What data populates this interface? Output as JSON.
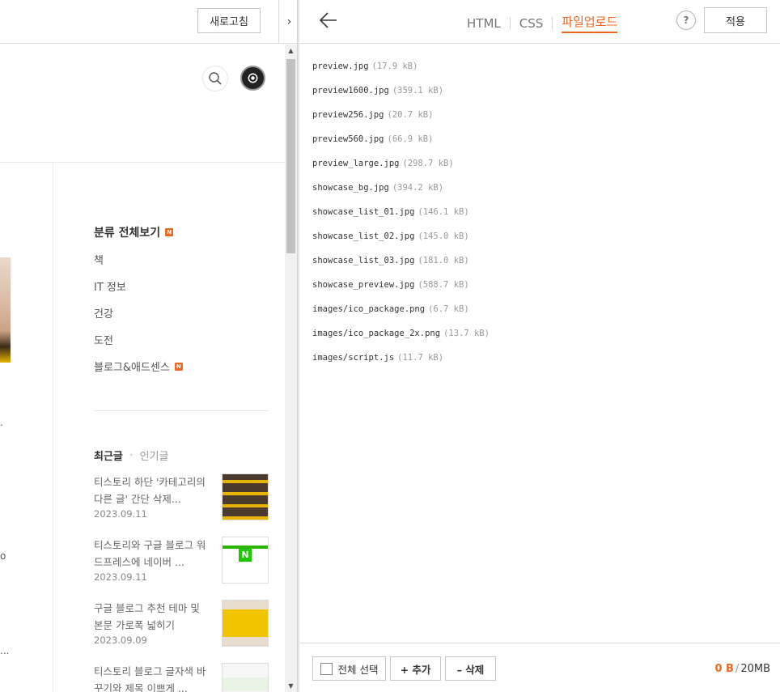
{
  "left": {
    "toolbar": {
      "refresh_label": "새로고침",
      "collapse_glyph": "›"
    },
    "blog": {
      "left_fragments": [
        ".",
        "o",
        "..."
      ],
      "categories": {
        "title": "분류 전체보기",
        "new_badge": "N",
        "items": [
          {
            "label": "책",
            "is_new": false
          },
          {
            "label": "IT 정보",
            "is_new": false
          },
          {
            "label": "건강",
            "is_new": false
          },
          {
            "label": "도전",
            "is_new": false
          },
          {
            "label": "블로그&애드센스",
            "is_new": true
          }
        ]
      },
      "tabs": {
        "recent": "최근글",
        "popular": "인기글"
      },
      "posts": [
        {
          "title": "티스토리 하단 '카테고리의 다른 글' 간단 삭제...",
          "date": "2023.09.11"
        },
        {
          "title": "티스토리와 구글 블로그 워드프레스에 네이버 ...",
          "date": "2023.09.11"
        },
        {
          "title": "구글 블로그 추천 테마 및 본문 가로폭 넓히기",
          "date": "2023.09.09"
        },
        {
          "title": "티스토리 블로그 글자색 바꾸기와 제목 이쁘게 ...",
          "date": ""
        }
      ]
    }
  },
  "right": {
    "toolbar": {
      "tabs": [
        {
          "label": "HTML",
          "active": false
        },
        {
          "label": "CSS",
          "active": false
        },
        {
          "label": "파일업로드",
          "active": true
        }
      ],
      "help_label": "?",
      "apply_label": "적용"
    },
    "files": [
      {
        "name": "preview.jpg",
        "size": "(17.9 kB)"
      },
      {
        "name": "preview1600.jpg",
        "size": "(359.1 kB)"
      },
      {
        "name": "preview256.jpg",
        "size": "(20.7 kB)"
      },
      {
        "name": "preview560.jpg",
        "size": "(66.9 kB)"
      },
      {
        "name": "preview_large.jpg",
        "size": "(298.7 kB)"
      },
      {
        "name": "showcase_bg.jpg",
        "size": "(394.2 kB)"
      },
      {
        "name": "showcase_list_01.jpg",
        "size": "(146.1 kB)"
      },
      {
        "name": "showcase_list_02.jpg",
        "size": "(145.0 kB)"
      },
      {
        "name": "showcase_list_03.jpg",
        "size": "(181.0 kB)"
      },
      {
        "name": "showcase_preview.jpg",
        "size": "(588.7 kB)"
      },
      {
        "name": "images/ico_package.png",
        "size": "(6.7 kB)"
      },
      {
        "name": "images/ico_package_2x.png",
        "size": "(13.7 kB)"
      },
      {
        "name": "images/script.js",
        "size": "(11.7 kB)"
      }
    ],
    "footer": {
      "select_all_label": "전체 선택",
      "add_label": "+ 추가",
      "delete_label": "– 삭제",
      "storage_used": "0 B",
      "storage_slash": "/",
      "storage_total": "20MB"
    }
  },
  "colors": {
    "accent": "#ee6723",
    "border": "#dcdcdc",
    "muted_text": "#999999"
  }
}
